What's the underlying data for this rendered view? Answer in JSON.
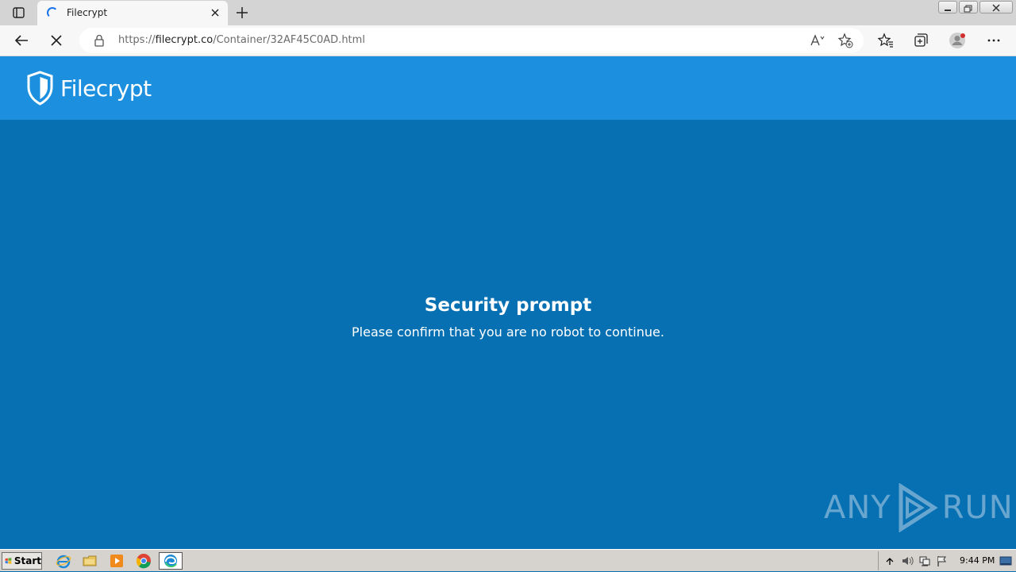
{
  "browser": {
    "tab": {
      "title": "Filecrypt"
    },
    "url": {
      "scheme": "https://",
      "host": "filecrypt.co",
      "path": "/Container/32AF45C0AD.html"
    }
  },
  "page": {
    "logo_text": "Filecrypt",
    "prompt_title": "Security prompt",
    "prompt_text": "Please confirm that you are no robot to continue.",
    "watermark_left": "ANY",
    "watermark_right": "RUN"
  },
  "taskbar": {
    "start_label": "Start",
    "clock": "9:44 PM"
  },
  "colors": {
    "header": "#1c90df",
    "content": "#0670b3"
  }
}
